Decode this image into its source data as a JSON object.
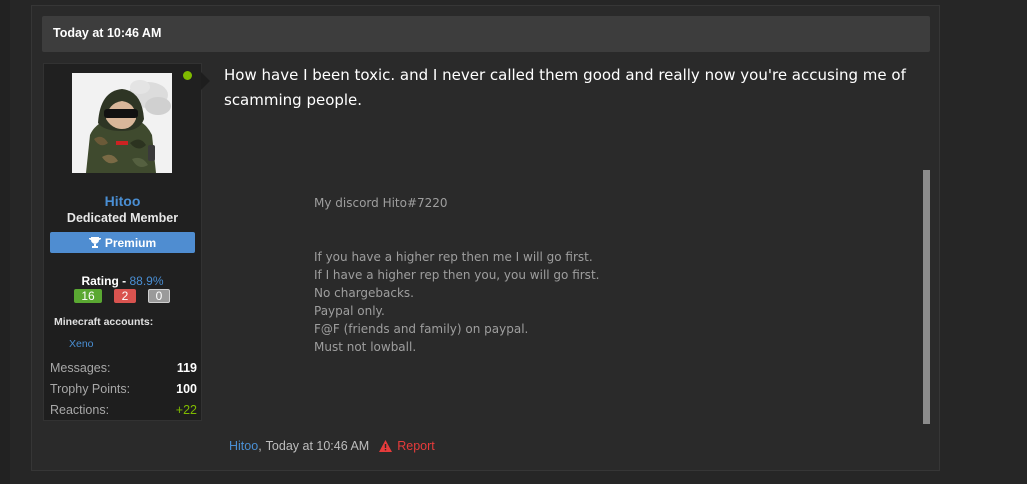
{
  "post": {
    "date_header": "Today at 10:46 AM",
    "message": "How have I been toxic. and I never called them good and really now you're accusing me of scamming people.",
    "signature": {
      "line1": "My discord Hito#7220",
      "rules": [
        "If you have a higher rep then me I will go first.",
        "If I have a higher rep then you, you will go first.",
        "No chargebacks.",
        "Paypal only.",
        "F@F (friends and family) on paypal.",
        "Must not lowball."
      ]
    },
    "footer": {
      "username": "Hitoo",
      "separator": ",",
      "time": "Today at 10:46 AM",
      "report_label": "Report"
    }
  },
  "user": {
    "name": "Hitoo",
    "title": "Dedicated Member",
    "banner": "Premium",
    "rating_label": "Rating -",
    "rating_value": "88.9%",
    "rating_positive": "16",
    "rating_negative": "2",
    "rating_neutral": "0",
    "minecraft_title": "Minecraft accounts:",
    "minecraft_account": "Xeno",
    "stats": [
      {
        "label": "Messages:",
        "value": "119"
      },
      {
        "label": "Trophy Points:",
        "value": "100"
      },
      {
        "label": "Reactions:",
        "value": "+22"
      }
    ],
    "online": true
  },
  "colors": {
    "accent_blue": "#4a8fd4",
    "online_green": "#7fba00",
    "report_red": "#e63b3b",
    "premium_banner": "#4f8dd1"
  },
  "icons": {
    "premium": "trophy-icon",
    "report": "warning-triangle-icon",
    "online": "online-indicator-icon"
  }
}
